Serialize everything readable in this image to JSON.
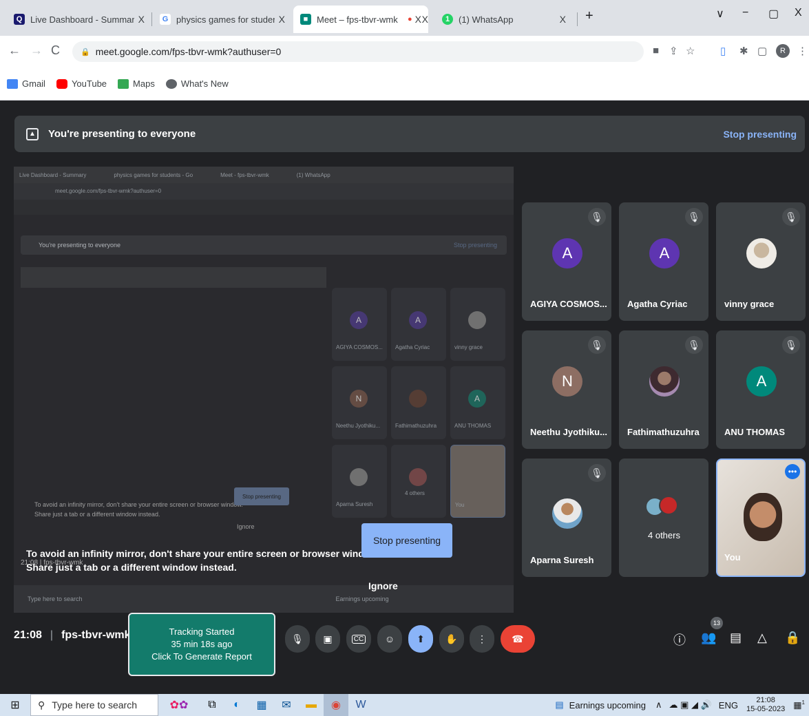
{
  "browser": {
    "tabs": [
      {
        "title": "Live Dashboard - Summary",
        "fav_color": "#1a1a6e",
        "fav_glyph": "Q"
      },
      {
        "title": "physics games for students - Goo",
        "fav_color": "#4285f4",
        "fav_glyph": "G"
      },
      {
        "title": "Meet – fps-tbvr-wmk",
        "fav_color": "#00897b",
        "fav_glyph": "■"
      },
      {
        "title": "",
        "fav_color": "#ea4335",
        "fav_glyph": "●"
      },
      {
        "title": "(1) WhatsApp",
        "fav_color": "#25d366",
        "fav_glyph": "1"
      }
    ],
    "close_glyph": "X",
    "new_tab": "+",
    "window_controls": [
      "∨",
      "−",
      "▢",
      "X"
    ],
    "url": "meet.google.com/fps-tbvr-wmk?authuser=0",
    "profile_initial": "R",
    "bookmarks": [
      {
        "label": "Gmail",
        "color": "#4285f4"
      },
      {
        "label": "YouTube",
        "color": "#ff0000"
      },
      {
        "label": "Maps",
        "color": "#34a853"
      },
      {
        "label": "What's New",
        "color": "#5f6368"
      }
    ]
  },
  "meet": {
    "banner_text": "You're presenting to everyone",
    "banner_stop": "Stop presenting",
    "participants": [
      {
        "name": "AGIYA COSMOS...",
        "initial": "A",
        "avatar_color": "#5e35b1",
        "type": "initial"
      },
      {
        "name": "Agatha Cyriac",
        "initial": "A",
        "avatar_color": "#5e35b1",
        "type": "initial"
      },
      {
        "name": "vinny grace",
        "initial": "",
        "avatar_color": "#e0e0e0",
        "type": "photo"
      },
      {
        "name": "Neethu Jyothiku...",
        "initial": "N",
        "avatar_color": "#8d6e63",
        "type": "initial"
      },
      {
        "name": "Fathimathuzuhra",
        "initial": "",
        "avatar_color": "#6d4c41",
        "type": "photo"
      },
      {
        "name": "ANU THOMAS",
        "initial": "A",
        "avatar_color": "#00897b",
        "type": "initial"
      },
      {
        "name": "Aparna Suresh",
        "initial": "",
        "avatar_color": "#90a4ae",
        "type": "photo"
      }
    ],
    "others_label": "4 others",
    "you_label": "You",
    "warning_line1": "To avoid an infinity mirror, don't share your entire screen or browser window.",
    "warning_line2": "Share just a tab or a different window instead.",
    "stop_button": "Stop presenting",
    "ignore_button": "Ignore",
    "time": "21:08",
    "meeting_code": "fps-tbvr-wmk",
    "tracking": {
      "line1": "Tracking Started",
      "line2": "35 min 18s ago",
      "line3": "Click To Generate Report"
    },
    "participant_count": "13"
  },
  "mirror": {
    "tabs": [
      "Live Dashboard - Summary",
      "physics games for students - Go",
      "Meet - fps-tbvr-wmk",
      "(1) WhatsApp"
    ],
    "url": "meet.google.com/fps-tbvr-wmk?authuser=0",
    "banner": "You're presenting to everyone",
    "stop": "Stop presenting",
    "tiles": [
      "AGIYA COSMOS...",
      "Agatha Cyriac",
      "vinny grace",
      "Neethu Jyothiku...",
      "Fathimathuzuhra",
      "ANU THOMAS",
      "Aparna Suresh",
      "4 others",
      "You"
    ],
    "warn1": "To avoid an infinity mirror, don't share your entire screen or browser window.",
    "warn2": "Share just a tab or a different window instead.",
    "ignore": "Ignore",
    "time": "21:08",
    "code": "fps-tbvr-wmk",
    "taskbar_search": "Type here to search",
    "taskbar_news": "Earnings upcoming"
  },
  "taskbar": {
    "search_placeholder": "Type here to search",
    "news": "Earnings upcoming",
    "lang": "ENG",
    "time": "21:08",
    "date": "15-05-2023",
    "notification_count": "1"
  }
}
